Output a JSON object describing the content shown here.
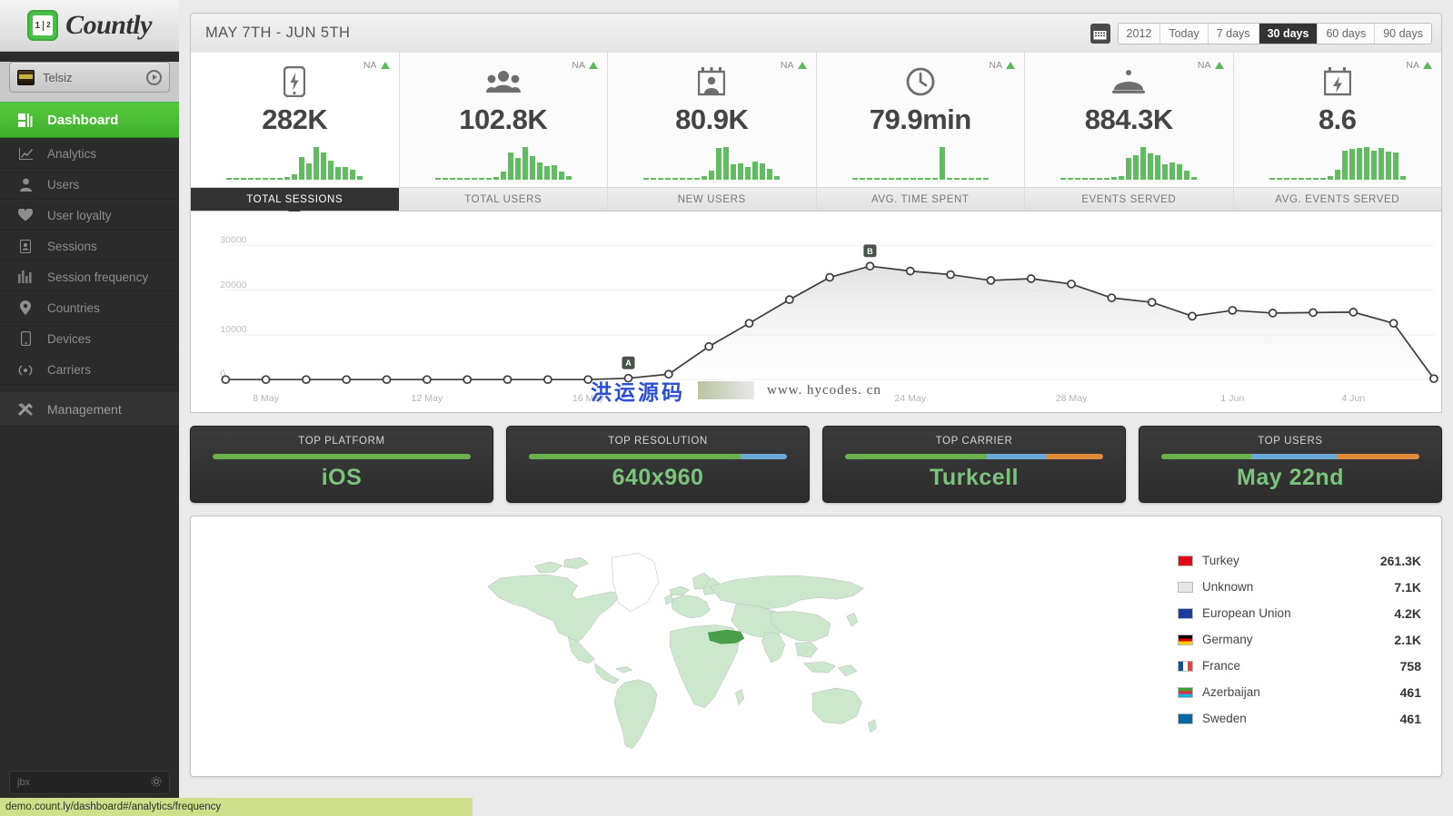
{
  "brand": {
    "name": "Countly",
    "logo_numerator": "1",
    "logo_denominator": "2"
  },
  "app_switcher": {
    "app_name": "Telsiz"
  },
  "sidebar": {
    "items": [
      {
        "label": "Dashboard",
        "icon": "dashboard-icon",
        "active": true
      },
      {
        "label": "Analytics",
        "icon": "analytics-icon",
        "active": false
      },
      {
        "label": "Users",
        "icon": "user-icon",
        "active": false
      },
      {
        "label": "User loyalty",
        "icon": "heart-icon",
        "active": false
      },
      {
        "label": "Sessions",
        "icon": "sessions-icon",
        "active": false
      },
      {
        "label": "Session frequency",
        "icon": "bar-chart-icon",
        "active": false
      },
      {
        "label": "Countries",
        "icon": "map-pin-icon",
        "active": false
      },
      {
        "label": "Devices",
        "icon": "device-icon",
        "active": false
      },
      {
        "label": "Carriers",
        "icon": "signal-icon",
        "active": false
      }
    ],
    "management": {
      "label": "Management",
      "icon": "tools-icon"
    },
    "footer": {
      "label": "jbx",
      "icon": "gear-icon"
    }
  },
  "header": {
    "date_range": "MAY 7TH - JUN 5TH",
    "calendar_icon": "calendar-icon",
    "range_options": [
      {
        "label": "2012",
        "active": false
      },
      {
        "label": "Today",
        "active": false
      },
      {
        "label": "7 days",
        "active": false
      },
      {
        "label": "30 days",
        "active": true
      },
      {
        "label": "60 days",
        "active": false
      },
      {
        "label": "90 days",
        "active": false
      }
    ]
  },
  "kpis": [
    {
      "label": "TOTAL SESSIONS",
      "value": "282K",
      "delta": "NA",
      "icon": "phone-bolt-icon",
      "selected": true,
      "spark": [
        3,
        3,
        3,
        3,
        3,
        3,
        3,
        3,
        5,
        10,
        42,
        30,
        60,
        50,
        35,
        24,
        24,
        18,
        6
      ]
    },
    {
      "label": "TOTAL USERS",
      "value": "102.8K",
      "delta": "NA",
      "icon": "users-icon",
      "selected": false,
      "spark": [
        3,
        3,
        3,
        3,
        3,
        3,
        3,
        3,
        5,
        14,
        48,
        38,
        58,
        42,
        30,
        24,
        26,
        14,
        6
      ]
    },
    {
      "label": "NEW USERS",
      "value": "80.9K",
      "delta": "NA",
      "icon": "calendar-user-icon",
      "selected": false,
      "spark": [
        3,
        3,
        3,
        3,
        3,
        3,
        3,
        3,
        6,
        16,
        58,
        60,
        28,
        30,
        24,
        34,
        30,
        20,
        6
      ]
    },
    {
      "label": "AVG. TIME SPENT",
      "value": "79.9min",
      "delta": "NA",
      "icon": "clock-icon",
      "selected": false,
      "spark": [
        2,
        2,
        2,
        2,
        2,
        2,
        2,
        2,
        2,
        2,
        2,
        2,
        50,
        2,
        2,
        2,
        2,
        2,
        2
      ]
    },
    {
      "label": "EVENTS SERVED",
      "value": "884.3K",
      "delta": "NA",
      "icon": "dome-icon",
      "selected": false,
      "spark": [
        3,
        3,
        3,
        3,
        3,
        3,
        3,
        5,
        6,
        38,
        44,
        58,
        46,
        44,
        28,
        30,
        28,
        16,
        5
      ]
    },
    {
      "label": "AVG. EVENTS SERVED",
      "value": "8.6",
      "delta": "NA",
      "icon": "calendar-bolt-icon",
      "selected": false,
      "spark": [
        3,
        3,
        3,
        3,
        3,
        3,
        3,
        4,
        6,
        18,
        52,
        54,
        56,
        58,
        52,
        56,
        50,
        48,
        6
      ]
    }
  ],
  "chart_data": {
    "type": "line",
    "title": "",
    "xlabel": "",
    "ylabel": "",
    "ylim": [
      0,
      34000
    ],
    "yticks": [
      "0",
      "10000",
      "20000",
      "30000"
    ],
    "ytick_values": [
      0,
      10000,
      20000,
      30000
    ],
    "xticks": [
      "8 May",
      "12 May",
      "16 May",
      "24 May",
      "28 May",
      "1 Jun",
      "4 Jun"
    ],
    "xtick_indices": [
      1,
      5,
      9,
      17,
      21,
      25,
      28
    ],
    "grid": true,
    "legend": "none",
    "categories": [
      "7 May",
      "8 May",
      "9 May",
      "10 May",
      "11 May",
      "12 May",
      "13 May",
      "14 May",
      "15 May",
      "16 May",
      "17 May",
      "18 May",
      "19 May",
      "20 May",
      "21 May",
      "22 May",
      "23 May",
      "24 May",
      "25 May",
      "26 May",
      "27 May",
      "28 May",
      "29 May",
      "30 May",
      "31 May",
      "1 Jun",
      "2 Jun",
      "3 Jun",
      "4 Jun",
      "5 Jun"
    ],
    "values": [
      0,
      0,
      0,
      0,
      0,
      0,
      0,
      0,
      0,
      0,
      300,
      1200,
      7400,
      12600,
      17900,
      22900,
      25400,
      24300,
      23500,
      22200,
      22600,
      21400,
      18300,
      17300,
      14200,
      15500,
      14900,
      15000,
      15100,
      12600,
      200
    ],
    "markers": [
      {
        "label": "A",
        "index": 10
      },
      {
        "label": "B",
        "index": 16
      }
    ],
    "watermark": {
      "cn": "洪运源码",
      "url": "www. hycodes. cn"
    }
  },
  "top_boxes": [
    {
      "title": "TOP PLATFORM",
      "value": "iOS",
      "segments": [
        {
          "color": "#6ab04c",
          "pct": 100
        }
      ]
    },
    {
      "title": "TOP RESOLUTION",
      "value": "640x960",
      "segments": [
        {
          "color": "#6ab04c",
          "pct": 82
        },
        {
          "color": "#6aa9d8",
          "pct": 18
        }
      ]
    },
    {
      "title": "TOP CARRIER",
      "value": "Turkcell",
      "segments": [
        {
          "color": "#6ab04c",
          "pct": 55
        },
        {
          "color": "#6aa9d8",
          "pct": 23
        },
        {
          "color": "#e08a3c",
          "pct": 22
        }
      ]
    },
    {
      "title": "TOP USERS",
      "value": "May 22nd",
      "segments": [
        {
          "color": "#6ab04c",
          "pct": 35
        },
        {
          "color": "#6aa9d8",
          "pct": 33
        },
        {
          "color": "#e08a3c",
          "pct": 32
        }
      ]
    }
  ],
  "map": {
    "highlight_country": "Turkey",
    "countries": [
      {
        "name": "Turkey",
        "value": "261.3K",
        "flag": "turkey-flag"
      },
      {
        "name": "Unknown",
        "value": "7.1K",
        "flag": "unknown-flag"
      },
      {
        "name": "European Union",
        "value": "4.2K",
        "flag": "eu-flag"
      },
      {
        "name": "Germany",
        "value": "2.1K",
        "flag": "germany-flag"
      },
      {
        "name": "France",
        "value": "758",
        "flag": "france-flag"
      },
      {
        "name": "Azerbaijan",
        "value": "461",
        "flag": "azerbaijan-flag"
      },
      {
        "name": "Sweden",
        "value": "461",
        "flag": "sweden-flag"
      }
    ]
  },
  "statusbar": {
    "url": "demo.count.ly/dashboard#/analytics/frequency"
  }
}
